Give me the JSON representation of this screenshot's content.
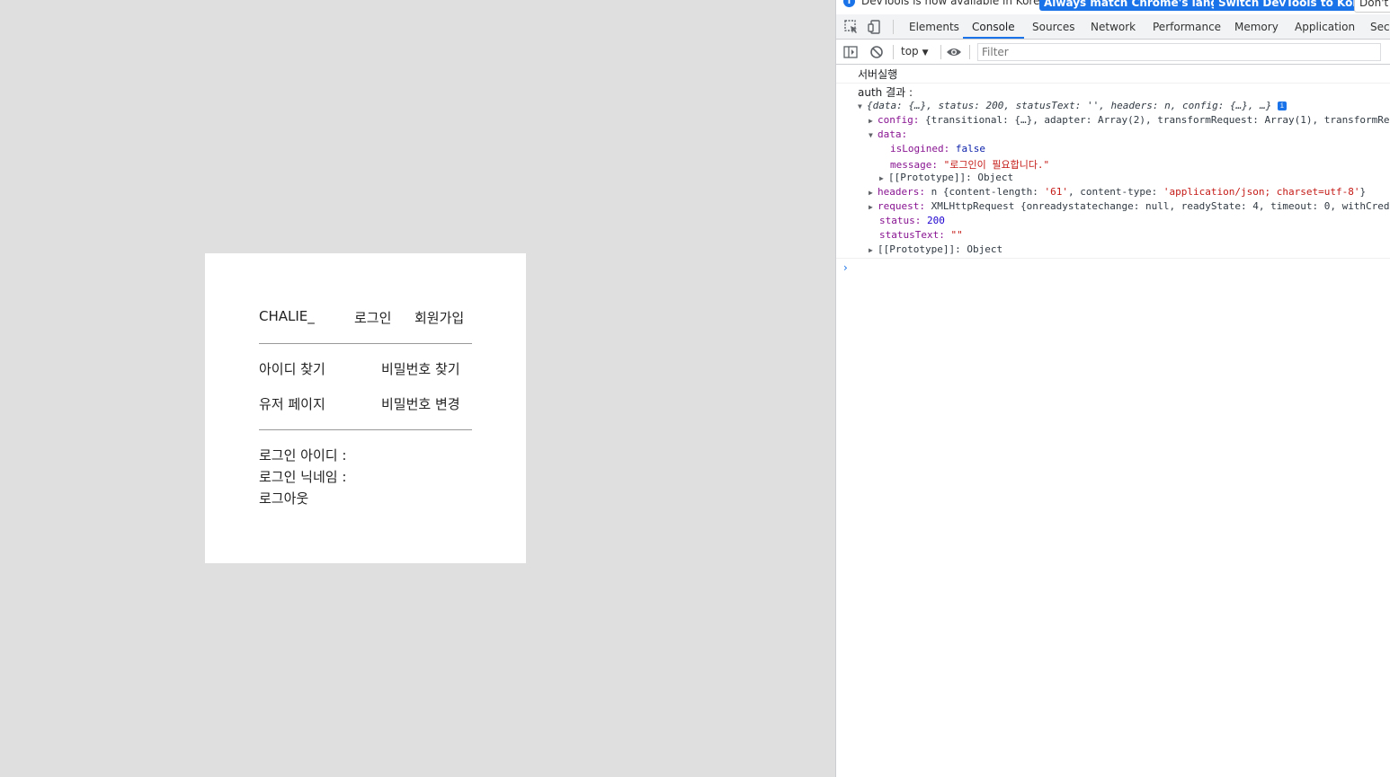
{
  "page": {
    "brand": "CHALIE_",
    "nav": {
      "login": "로그인",
      "signup": "회원가입"
    },
    "links": {
      "find_id": "아이디 찾기",
      "find_password": "비밀번호 찾기",
      "user_page": "유저 페이지",
      "change_password": "비밀번호 변경"
    },
    "info": {
      "login_id": "로그인 아이디 :",
      "login_nickname": "로그인 닉네임 :",
      "logout": "로그아웃"
    }
  },
  "devtools": {
    "infobar": {
      "message": "DevTools is now available in Korean!",
      "btn_match": "Always match Chrome's language",
      "btn_switch": "Switch DevTools to Korean",
      "btn_dont": "Don't s"
    },
    "tabs": [
      "Elements",
      "Console",
      "Sources",
      "Network",
      "Performance",
      "Memory",
      "Application",
      "Secu"
    ],
    "active_tab": "Console",
    "context": "top",
    "filter_placeholder": "Filter",
    "console": {
      "log1": "서버실행",
      "log2": "auth 결과 :",
      "obj_summary": "{data: {…}, status: 200, statusText: '', headers: n, config: {…}, …}",
      "config_key": "config:",
      "config_val": "{transitional: {…}, adapter: Array(2), transformRequest: Array(1), transformRe",
      "data_key": "data:",
      "islogined_key": "isLogined:",
      "islogined_val": "false",
      "message_key": "message:",
      "message_val": "\"로그인이 필요합니다.\"",
      "proto_key": "[[Prototype]]:",
      "proto_val": "Object",
      "headers_key": "headers:",
      "headers_val_prefix": "n {content-length: ",
      "headers_cl": "'61'",
      "headers_mid": ", content-type: ",
      "headers_ct": "'application/json; charset=utf-8'",
      "headers_end": "}",
      "request_key": "request:",
      "request_val": "XMLHttpRequest {onreadystatechange: null, readyState: 4, timeout: 0, withCrede",
      "status_key": "status:",
      "status_val": "200",
      "statustext_key": "statusText:",
      "statustext_val": "\"\"",
      "proto2_key": "[[Prototype]]:",
      "proto2_val": "Object"
    }
  },
  "colors": {
    "accent": "#1a73e8",
    "key": "#881391",
    "string": "#c41a16",
    "number": "#1c00cf"
  }
}
